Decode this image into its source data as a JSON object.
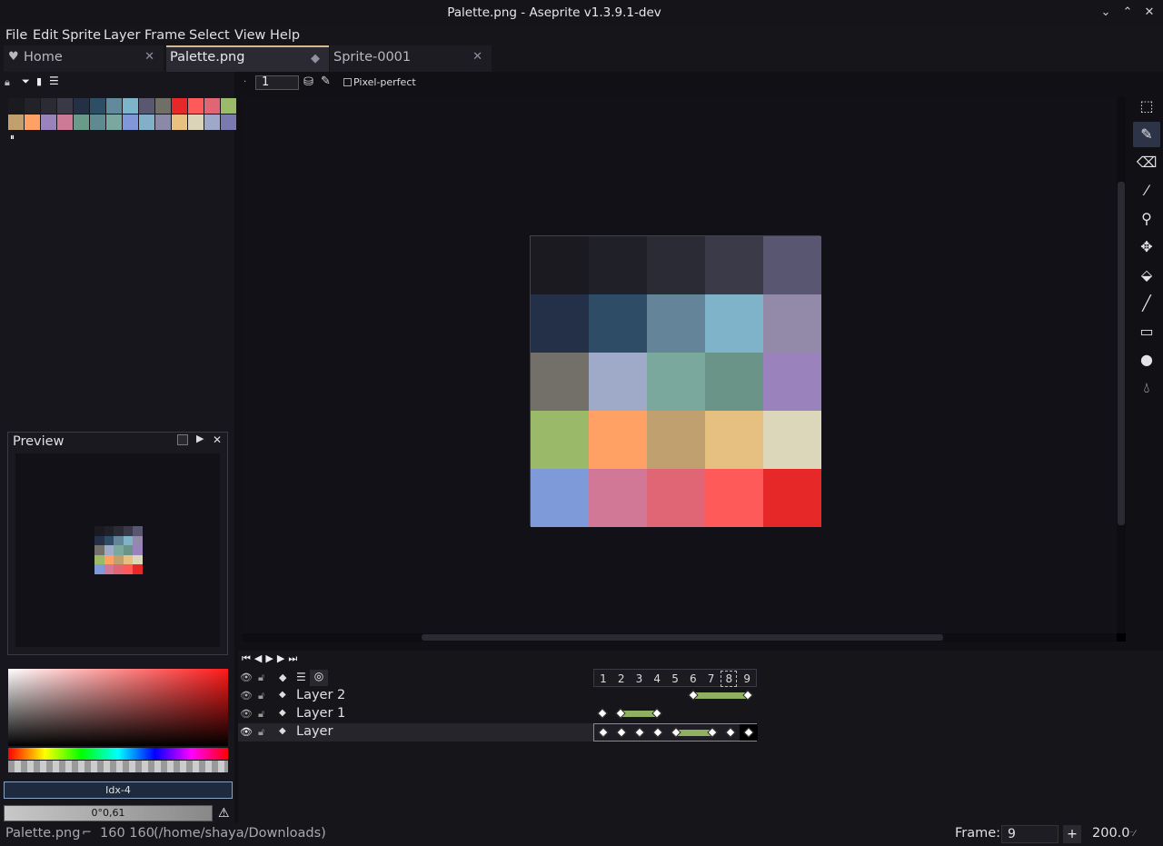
{
  "window": {
    "title": "Palette.png - Aseprite v1.3.9.1-dev"
  },
  "menu": [
    "File",
    "Edit",
    "Sprite",
    "Layer",
    "Frame",
    "Select",
    "View",
    "Help"
  ],
  "tabs": [
    {
      "label": "Home",
      "close": "✕"
    },
    {
      "label": "Palette.png",
      "close": "◆"
    },
    {
      "label": "Sprite-0001",
      "close": "✕"
    }
  ],
  "toolbar": {
    "brush_size": "1",
    "pixel_perfect_label": "Pixel-perfect"
  },
  "palette": {
    "row1": [
      "#1a1a1f",
      "#222229",
      "#2b2b33",
      "#3a3a46",
      "#233045",
      "#2d4f66",
      "#628a9c",
      "#7eb4c9",
      "#5a5870",
      "#706f66",
      "#e62828",
      "#ff5a5a",
      "#e06575",
      "#9bbb6a"
    ],
    "row2": [
      "#c2a06e",
      "#ffa064",
      "#9a82bc",
      "#cc7a96",
      "#6a9a8a",
      "#5f8a90",
      "#7aa8a0",
      "#8098d8",
      "#82b0c8",
      "#8a89a8",
      "#e8c080",
      "#dcd4b8",
      "#9ea8c8",
      "#7a7ab0"
    ]
  },
  "preview": {
    "title": "Preview"
  },
  "sprite_colors": [
    "#1a1a20",
    "#202028",
    "#2b2b36",
    "#3a3a48",
    "#585670",
    "#243048",
    "#2e4c66",
    "#648499",
    "#7fb3c9",
    "#928aa8",
    "#727068",
    "#9eaac8",
    "#7aa89c",
    "#6a9488",
    "#9a82bc",
    "#9aba6a",
    "#ffa064",
    "#c0a06e",
    "#e6c080",
    "#dcd6ba",
    "#7e9ad8",
    "#d07896",
    "#e06575",
    "#ff5a5a",
    "#e62828"
  ],
  "color_picker": {
    "index_label": "Idx-4",
    "alpha_value": "0°0,61"
  },
  "timeline": {
    "frames": [
      "1",
      "2",
      "3",
      "4",
      "5",
      "6",
      "7",
      "8",
      "9"
    ],
    "layers": [
      {
        "name": "Layer 2"
      },
      {
        "name": "Layer 1"
      },
      {
        "name": "Layer"
      }
    ]
  },
  "status": {
    "filename": "Palette.png",
    "size": "160 160",
    "path": "(/home/shaya/Downloads)",
    "frame_label": "Frame:",
    "frame_value": "9",
    "plus": "+",
    "zoom": "200.0"
  }
}
